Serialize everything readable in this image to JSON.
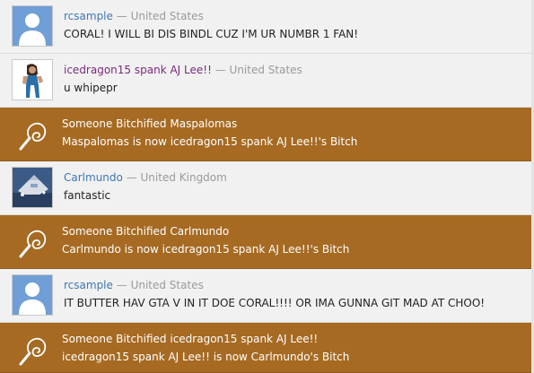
{
  "feed": {
    "items": [
      {
        "type": "comment",
        "username": "rcsample",
        "separator": "—",
        "location": "United States",
        "text": "CORAL! I WILL BI DIS BINDL CUZ I'M UR NUMBR 1 FAN!",
        "avatar": "default-avatar"
      },
      {
        "type": "comment",
        "username": "icedragon15 spank AJ Lee!!",
        "separator": "—",
        "location": "United States",
        "text": "u whipepr",
        "avatar": "wrestler-avatar"
      },
      {
        "type": "event",
        "title": "Someone Bitchified Maspalomas",
        "text": "Maspalomas is now icedragon15 spank AJ Lee!!'s Bitch",
        "icon": "whip-icon"
      },
      {
        "type": "comment",
        "username": "Carlmundo",
        "separator": "—",
        "location": "United Kingdom",
        "text": "fantastic",
        "avatar": "spaceship-avatar"
      },
      {
        "type": "event",
        "title": "Someone Bitchified Carlmundo",
        "text": "Carlmundo is now icedragon15 spank AJ Lee!!'s Bitch",
        "icon": "whip-icon"
      },
      {
        "type": "comment",
        "username": "rcsample",
        "separator": "—",
        "location": "United States",
        "text": "IT BUTTER HAV GTA V IN IT DOE CORAL!!!! OR IMA GUNNA GIT MAD AT CHOO!",
        "avatar": "default-avatar"
      },
      {
        "type": "event",
        "title": "Someone Bitchified icedragon15 spank AJ Lee!!",
        "text": "icedragon15 spank AJ Lee!! is now Carlmundo's Bitch",
        "icon": "whip-icon"
      }
    ]
  },
  "colors": {
    "event_bg": "#a66a22",
    "comment_bg": "#f1f1f1",
    "username": "#3f77b3",
    "username_alt": "#7b2a7d",
    "location": "#9a9a9a"
  }
}
